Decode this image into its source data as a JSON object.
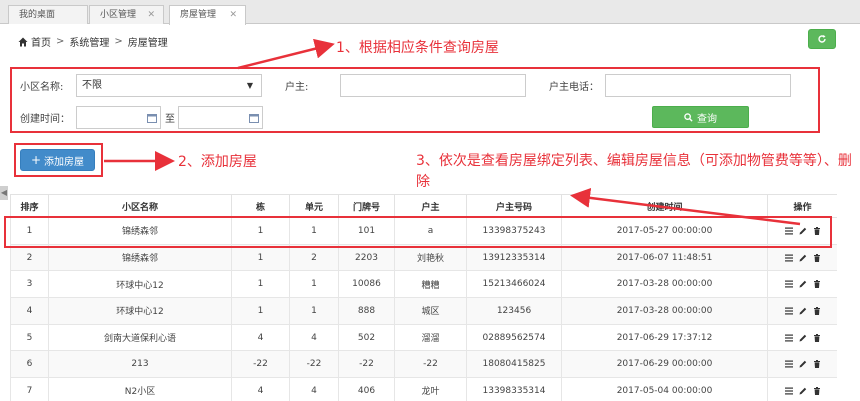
{
  "tabs": [
    {
      "label": "我的桌面",
      "closable": false,
      "active": false
    },
    {
      "label": "小区管理",
      "closable": true,
      "active": false
    },
    {
      "label": "房屋管理",
      "closable": true,
      "active": true
    }
  ],
  "breadcrumb": {
    "home": "首页",
    "section": "系统管理",
    "page": "房屋管理"
  },
  "filters": {
    "community_label": "小区名称:",
    "community_value": "不限",
    "owner_label": "户主:",
    "owner_value": "",
    "phone_label": "户主电话：",
    "phone_value": "",
    "created_label": "创建时间：",
    "to_label": "至",
    "query_label": "查询"
  },
  "add_button": {
    "label": "添加房屋"
  },
  "annotations": {
    "a1": "1、根据相应条件查询房屋",
    "a2": "2、添加房屋",
    "a3": "3、依次是查看房屋绑定列表、编辑房屋信息（可添加物管费等等）、删除"
  },
  "table": {
    "headers": [
      "排序",
      "小区名称",
      "栋",
      "单元",
      "门牌号",
      "户主",
      "户主号码",
      "创建时间",
      "操作"
    ],
    "rows": [
      [
        "1",
        "锦绣森邻",
        "1",
        "1",
        "101",
        "a",
        "13398375243",
        "2017-05-27 00:00:00"
      ],
      [
        "2",
        "锦绣森邻",
        "1",
        "2",
        "2203",
        "刘艳秋",
        "13912335314",
        "2017-06-07 11:48:51"
      ],
      [
        "3",
        "环球中心12",
        "1",
        "1",
        "10086",
        "糟糟",
        "15213466024",
        "2017-03-28 00:00:00"
      ],
      [
        "4",
        "环球中心12",
        "1",
        "1",
        "888",
        "城区",
        "123456",
        "2017-03-28 00:00:00"
      ],
      [
        "5",
        "剑南大道保利心语",
        "4",
        "4",
        "502",
        "溜溜",
        "02889562574",
        "2017-06-29 17:37:12"
      ],
      [
        "6",
        "213",
        "-22",
        "-22",
        "-22",
        "-22",
        "18080415825",
        "2017-06-29 00:00:00"
      ],
      [
        "7",
        "N2小区",
        "4",
        "4",
        "406",
        "龙叶",
        "13398335314",
        "2017-05-04 00:00:00"
      ]
    ]
  },
  "colors": {
    "accent_red": "#e8313a",
    "green": "#5cb85c",
    "blue": "#428bca"
  }
}
